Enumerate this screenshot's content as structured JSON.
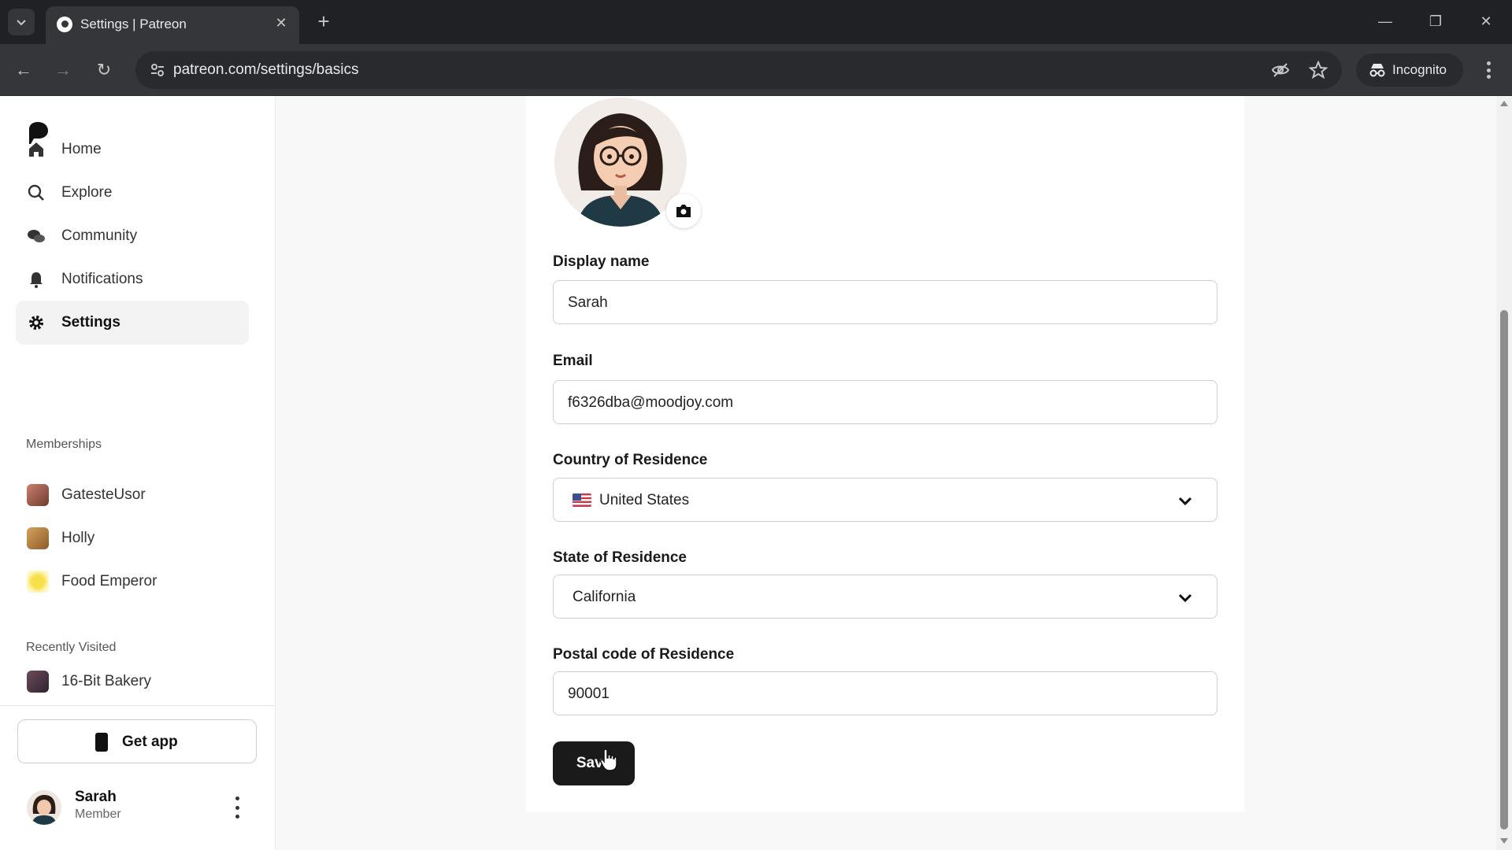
{
  "browser": {
    "tab_title": "Settings | Patreon",
    "url": "patreon.com/settings/basics",
    "incognito_label": "Incognito",
    "icons": [
      "chevron-down-icon",
      "close-icon",
      "plus-icon",
      "minimize-icon",
      "restore-icon",
      "back-icon",
      "forward-icon",
      "reload-icon",
      "site-settings-icon",
      "eye-off-icon",
      "star-icon",
      "incognito-icon",
      "more-vert-icon"
    ]
  },
  "sidebar": {
    "nav": [
      {
        "label": "Home",
        "icon": "home-icon"
      },
      {
        "label": "Explore",
        "icon": "search-icon"
      },
      {
        "label": "Community",
        "icon": "chat-bubbles-icon"
      },
      {
        "label": "Notifications",
        "icon": "bell-icon"
      },
      {
        "label": "Settings",
        "icon": "gear-icon",
        "active": true
      }
    ],
    "memberships_heading": "Memberships",
    "memberships": [
      {
        "label": "GatesteUsor"
      },
      {
        "label": "Holly"
      },
      {
        "label": "Food Emperor"
      }
    ],
    "recently_visited_heading": "Recently Visited",
    "recently_visited": [
      {
        "label": "16-Bit Bakery"
      }
    ],
    "get_app_label": "Get app",
    "profile": {
      "name": "Sarah",
      "role": "Member"
    }
  },
  "form": {
    "display_name": {
      "label": "Display name",
      "value": "Sarah"
    },
    "email": {
      "label": "Email",
      "value": "f6326dba@moodjoy.com"
    },
    "country": {
      "label": "Country of Residence",
      "value": "United States"
    },
    "state": {
      "label": "State of Residence",
      "value": "California"
    },
    "postal": {
      "label": "Postal code of Residence",
      "value": "90001"
    },
    "save_label": "Save"
  },
  "colors": {
    "accent": "#1a1a1a",
    "active_nav_bg": "#f3f3f3",
    "chrome_bg": "#202124"
  }
}
